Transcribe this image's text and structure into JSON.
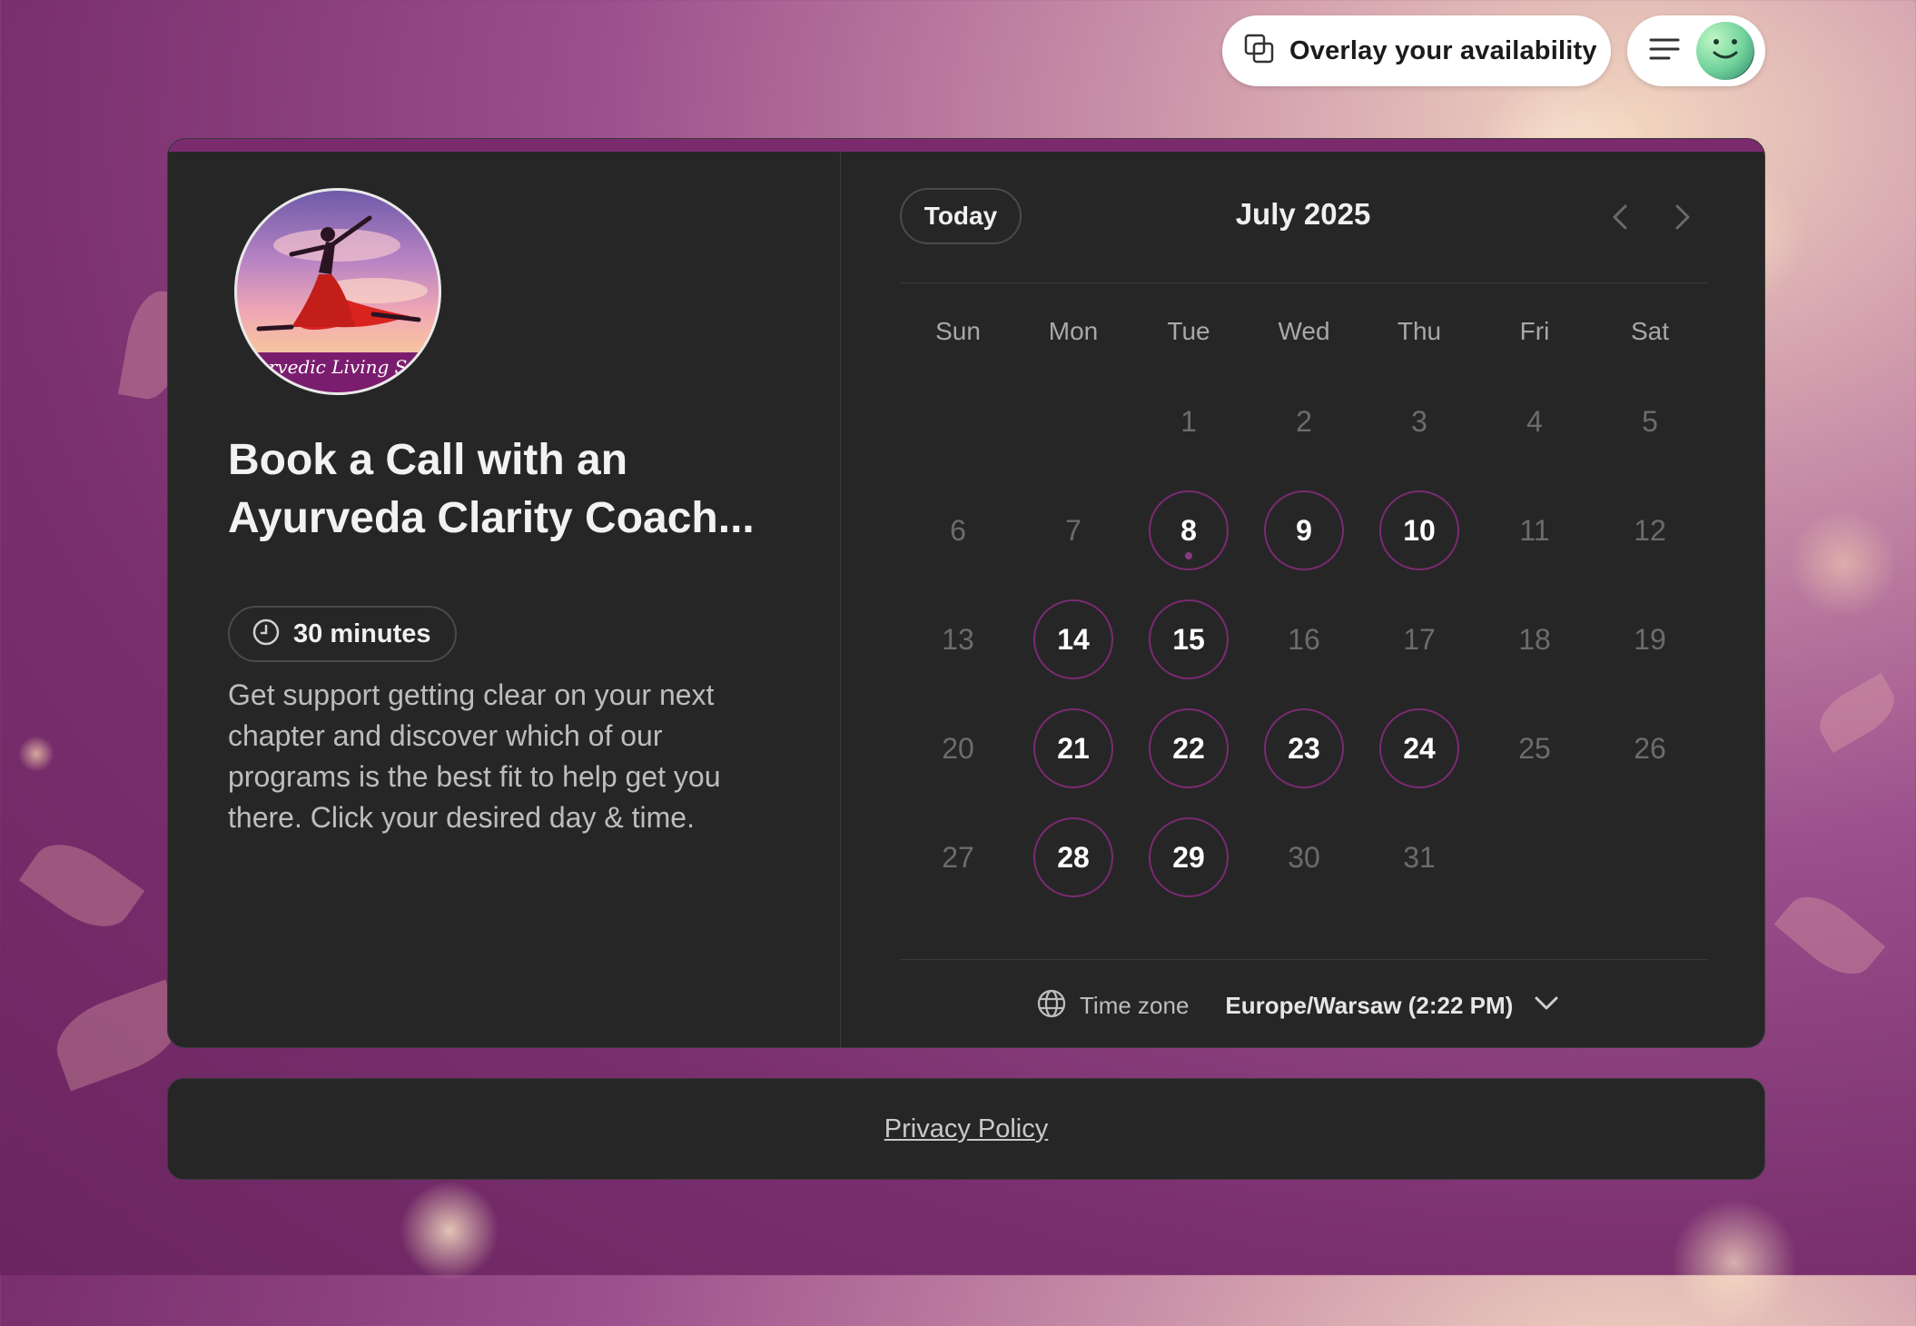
{
  "header": {
    "overlay_label": "Overlay your availability"
  },
  "event": {
    "banner_text": "yurvedic Living Sch",
    "title": "Book a Call with an Ayurveda Clarity Coach...",
    "duration": "30 minutes",
    "description": "Get support getting clear on your next chapter and discover which of our programs is the best fit to help get you there. Click your desired day & time."
  },
  "calendar": {
    "today_label": "Today",
    "month": "July 2025",
    "weekdays": [
      "Sun",
      "Mon",
      "Tue",
      "Wed",
      "Thu",
      "Fri",
      "Sat"
    ],
    "weeks": [
      [
        null,
        null,
        "1",
        "2",
        "3",
        "4",
        "5"
      ],
      [
        "6",
        "7",
        "8",
        "9",
        "10",
        "11",
        "12"
      ],
      [
        "13",
        "14",
        "15",
        "16",
        "17",
        "18",
        "19"
      ],
      [
        "20",
        "21",
        "22",
        "23",
        "24",
        "25",
        "26"
      ],
      [
        "27",
        "28",
        "29",
        "30",
        "31",
        null,
        null
      ]
    ],
    "available_days": [
      "8",
      "9",
      "10",
      "14",
      "15",
      "21",
      "22",
      "23",
      "24",
      "28",
      "29"
    ],
    "today_day": "8"
  },
  "timezone": {
    "label": "Time zone",
    "value": "Europe/Warsaw (2:22 PM)"
  },
  "footer": {
    "privacy_label": "Privacy Policy"
  },
  "colors": {
    "accent": "#7b2a72",
    "card_bg": "#262626",
    "card_topbar": "#7a2a6d"
  }
}
